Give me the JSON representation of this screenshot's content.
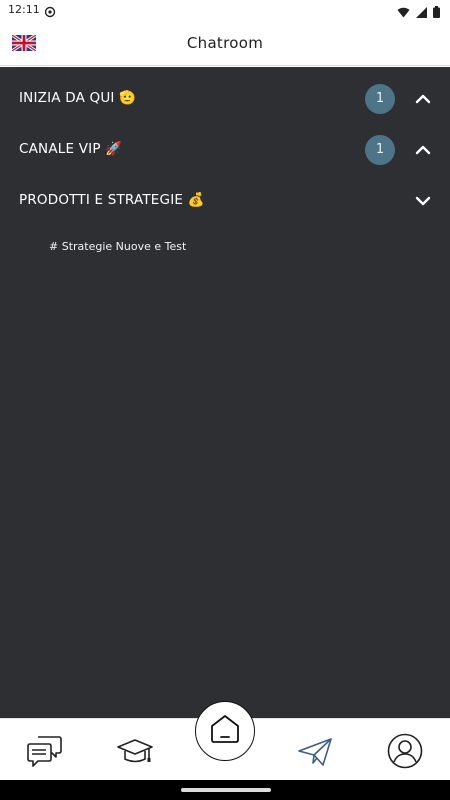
{
  "status_bar": {
    "time": "12:11",
    "left_icon": "notification-icon",
    "right_icons": [
      "wifi-icon",
      "signal-icon",
      "battery-icon"
    ]
  },
  "header": {
    "title": "Chatroom",
    "language_icon": "uk-flag-icon"
  },
  "sections": [
    {
      "label": "INIZIA DA QUI 🫡",
      "badge": "1",
      "expanded": false,
      "chevron": "chevron-up-icon"
    },
    {
      "label": "CANALE VIP 🚀",
      "badge": "1",
      "expanded": false,
      "chevron": "chevron-up-icon"
    },
    {
      "label": "PRODOTTI E STRATEGIE 💰",
      "badge": "",
      "expanded": true,
      "chevron": "chevron-down-icon",
      "channels": [
        "# Strategie Nuove e Test"
      ]
    }
  ],
  "bottom_nav": {
    "items": [
      {
        "name": "chat",
        "icon": "chat-bubbles-icon"
      },
      {
        "name": "courses",
        "icon": "graduation-cap-icon"
      },
      {
        "name": "home",
        "icon": "home-icon"
      },
      {
        "name": "send",
        "icon": "paper-plane-icon"
      },
      {
        "name": "profile",
        "icon": "profile-icon"
      }
    ]
  },
  "colors": {
    "content_bg": "#2d2f33",
    "badge_bg": "#4d7487",
    "accent_plane": "#3b5f82"
  }
}
